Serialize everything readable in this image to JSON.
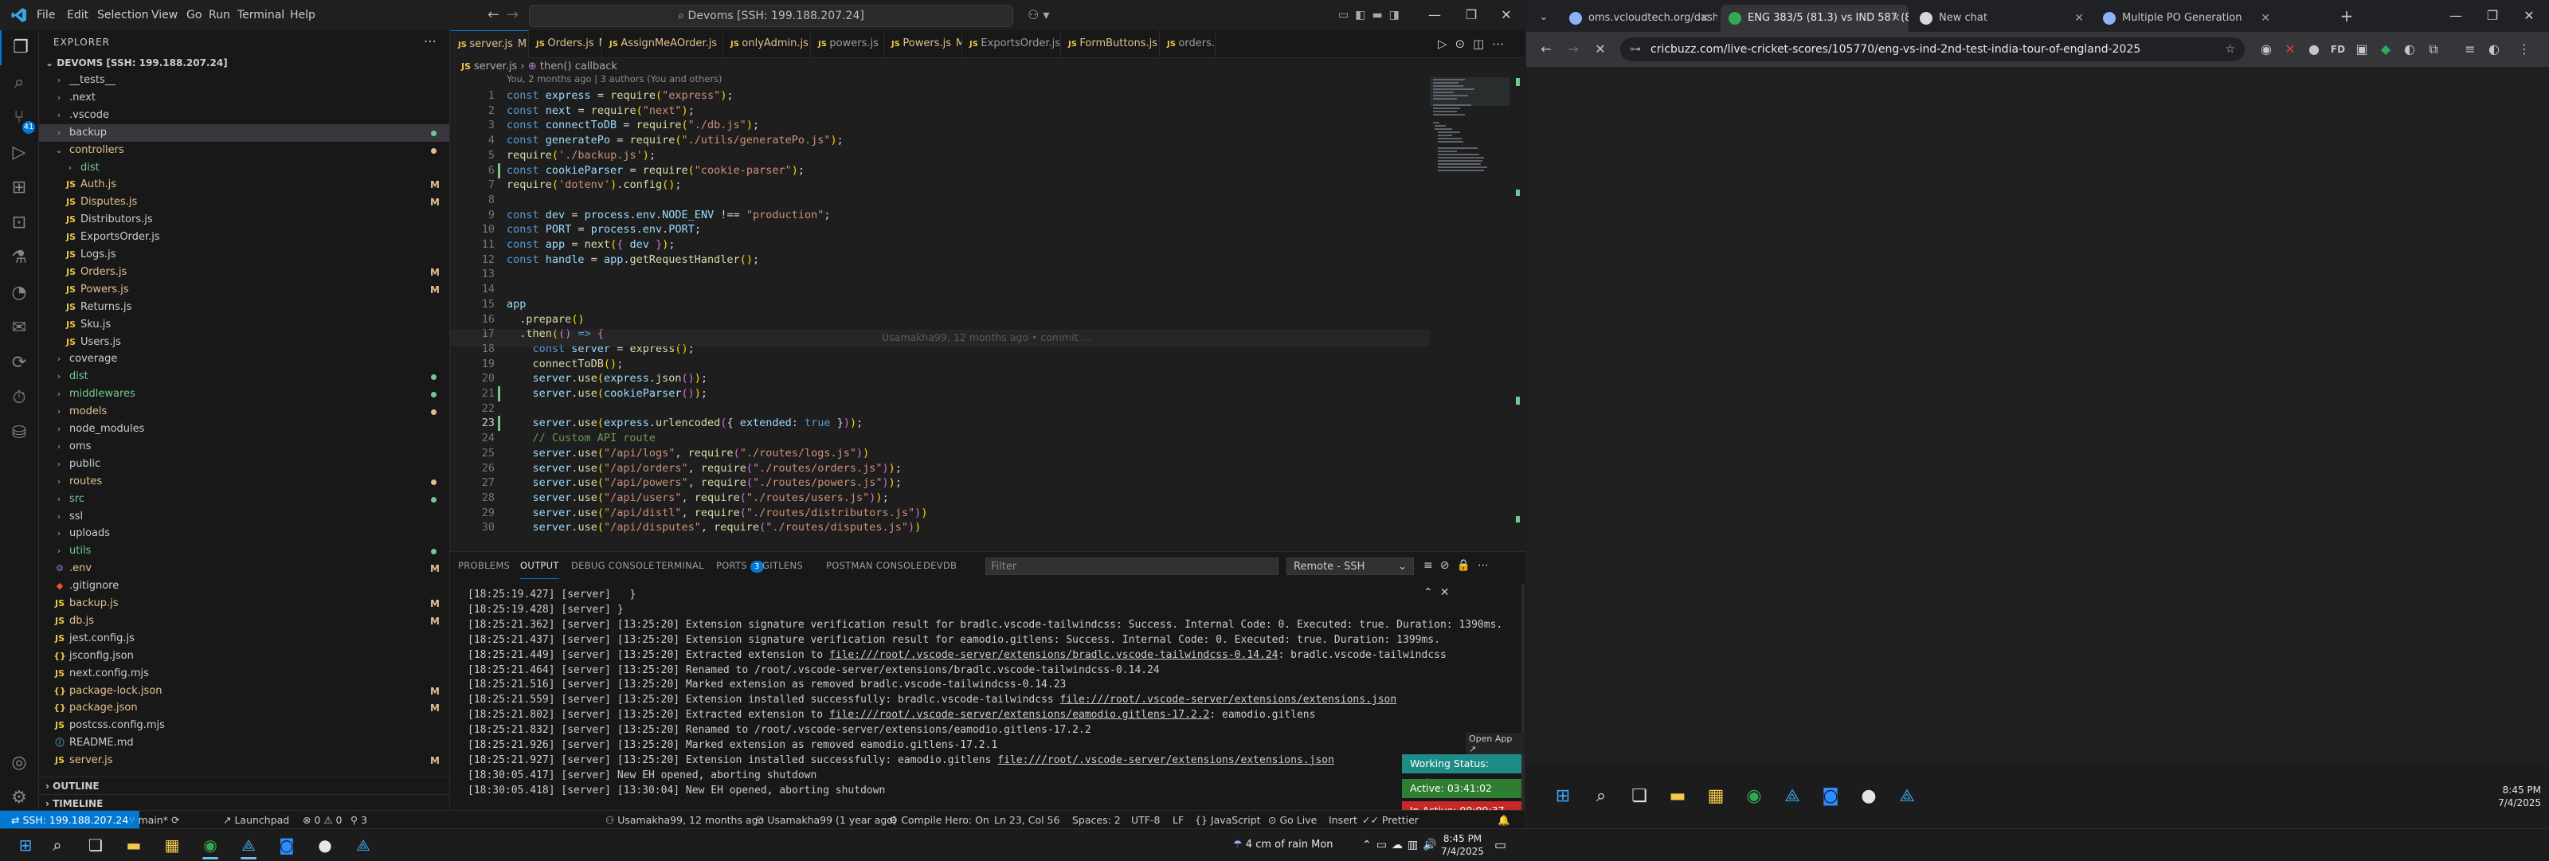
{
  "vscode": {
    "menus": [
      "File",
      "Edit",
      "Selection",
      "View",
      "Go",
      "Run",
      "Terminal",
      "Help"
    ],
    "command_center": "Devoms [SSH: 199.188.207.24]",
    "explorer_title": "EXPLORER",
    "workspace_name": "DEVOMS [SSH: 199.188.207.24]",
    "tree": [
      {
        "label": "__tests__",
        "kind": "folder",
        "open": false,
        "depth": 1,
        "color": "#cccccc"
      },
      {
        "label": ".next",
        "kind": "folder",
        "open": false,
        "depth": 1,
        "color": "#cccccc"
      },
      {
        "label": ".vscode",
        "kind": "folder",
        "open": false,
        "depth": 1,
        "color": "#cccccc"
      },
      {
        "label": "backup",
        "kind": "folder",
        "open": false,
        "depth": 1,
        "color": "#cccccc",
        "dot": "#73c991",
        "selected": true
      },
      {
        "label": "controllers",
        "kind": "folder",
        "open": true,
        "depth": 1,
        "color": "#e2c08d",
        "dot": "#e2c08d"
      },
      {
        "label": "dist",
        "kind": "folder",
        "open": false,
        "depth": 2,
        "color": "#73c991"
      },
      {
        "label": "Auth.js",
        "kind": "js",
        "depth": 2,
        "color": "#e2c08d",
        "status": "M"
      },
      {
        "label": "Disputes.js",
        "kind": "js",
        "depth": 2,
        "color": "#e2c08d",
        "status": "M"
      },
      {
        "label": "Distributors.js",
        "kind": "js",
        "depth": 2,
        "color": "#cccccc"
      },
      {
        "label": "ExportsOrder.js",
        "kind": "js",
        "depth": 2,
        "color": "#cccccc"
      },
      {
        "label": "Logs.js",
        "kind": "js",
        "depth": 2,
        "color": "#cccccc"
      },
      {
        "label": "Orders.js",
        "kind": "js",
        "depth": 2,
        "color": "#e2c08d",
        "status": "M"
      },
      {
        "label": "Powers.js",
        "kind": "js",
        "depth": 2,
        "color": "#e2c08d",
        "status": "M"
      },
      {
        "label": "Returns.js",
        "kind": "js",
        "depth": 2,
        "color": "#cccccc"
      },
      {
        "label": "Sku.js",
        "kind": "js",
        "depth": 2,
        "color": "#cccccc"
      },
      {
        "label": "Users.js",
        "kind": "js",
        "depth": 2,
        "color": "#cccccc"
      },
      {
        "label": "coverage",
        "kind": "folder",
        "open": false,
        "depth": 1,
        "color": "#cccccc"
      },
      {
        "label": "dist",
        "kind": "folder",
        "open": false,
        "depth": 1,
        "color": "#73c991",
        "dot": "#73c991"
      },
      {
        "label": "middlewares",
        "kind": "folder",
        "open": false,
        "depth": 1,
        "color": "#73c991",
        "dot": "#73c991"
      },
      {
        "label": "models",
        "kind": "folder",
        "open": false,
        "depth": 1,
        "color": "#e2c08d",
        "dot": "#e2c08d"
      },
      {
        "label": "node_modules",
        "kind": "folder",
        "open": false,
        "depth": 1,
        "color": "#cccccc"
      },
      {
        "label": "oms",
        "kind": "folder",
        "open": false,
        "depth": 1,
        "color": "#cccccc"
      },
      {
        "label": "public",
        "kind": "folder",
        "open": false,
        "depth": 1,
        "color": "#cccccc"
      },
      {
        "label": "routes",
        "kind": "folder",
        "open": false,
        "depth": 1,
        "color": "#e2c08d",
        "dot": "#e2c08d"
      },
      {
        "label": "src",
        "kind": "folder",
        "open": false,
        "depth": 1,
        "color": "#73c991",
        "dot": "#73c991"
      },
      {
        "label": "ssl",
        "kind": "folder",
        "open": false,
        "depth": 1,
        "color": "#cccccc"
      },
      {
        "label": "uploads",
        "kind": "folder",
        "open": false,
        "depth": 1,
        "color": "#cccccc"
      },
      {
        "label": "utils",
        "kind": "folder",
        "open": false,
        "depth": 1,
        "color": "#73c991",
        "dot": "#73c991"
      },
      {
        "label": ".env",
        "kind": "env",
        "depth": 1,
        "color": "#e2c08d",
        "status": "M"
      },
      {
        "label": ".gitignore",
        "kind": "git",
        "depth": 1,
        "color": "#cccccc"
      },
      {
        "label": "backup.js",
        "kind": "js",
        "depth": 1,
        "color": "#e2c08d",
        "status": "M"
      },
      {
        "label": "db.js",
        "kind": "js",
        "depth": 1,
        "color": "#e2c08d",
        "status": "M"
      },
      {
        "label": "jest.config.js",
        "kind": "js",
        "depth": 1,
        "color": "#cccccc"
      },
      {
        "label": "jsconfig.json",
        "kind": "json",
        "depth": 1,
        "color": "#cccccc"
      },
      {
        "label": "next.config.mjs",
        "kind": "js",
        "depth": 1,
        "color": "#cccccc"
      },
      {
        "label": "package-lock.json",
        "kind": "json",
        "depth": 1,
        "color": "#e2c08d",
        "status": "M"
      },
      {
        "label": "package.json",
        "kind": "json",
        "depth": 1,
        "color": "#e2c08d",
        "status": "M"
      },
      {
        "label": "postcss.config.mjs",
        "kind": "js",
        "depth": 1,
        "color": "#cccccc"
      },
      {
        "label": "README.md",
        "kind": "md",
        "depth": 1,
        "color": "#cccccc"
      },
      {
        "label": "server.js",
        "kind": "js",
        "depth": 1,
        "color": "#e2c08d",
        "status": "M"
      }
    ],
    "outline_label": "OUTLINE",
    "timeline_label": "TIMELINE",
    "tabs": [
      {
        "label": "server.js",
        "status": "M",
        "active": true,
        "close": "×"
      },
      {
        "label": "Orders.js",
        "status": "M"
      },
      {
        "label": "AssignMeAOrder.js",
        "status": "M"
      },
      {
        "label": "onlyAdmin.js",
        "status": "M"
      },
      {
        "label": "powers.js",
        "status": ""
      },
      {
        "label": "Powers.js",
        "status": "M"
      },
      {
        "label": "ExportsOrder.js",
        "status": ""
      },
      {
        "label": "FormButtons.js",
        "status": "M"
      },
      {
        "label": "orders.js",
        "status": ""
      }
    ],
    "breadcrumb": [
      "server.js",
      "then() callback"
    ],
    "blame_header": "You, 2 months ago | 3 authors (You and others)",
    "inline_blame": "Usamakha99, 12 months ago • commit …",
    "code": [
      {
        "n": "1",
        "html": "<span class='k'>const</span> <span class='v'>express</span> <span class='p'>=</span> <span class='f'>require</span><span class='br'>(</span><span class='s'>\"express\"</span><span class='br'>)</span><span class='p'>;</span>"
      },
      {
        "n": "2",
        "html": "<span class='k'>const</span> <span class='v'>next</span> <span class='p'>=</span> <span class='f'>require</span><span class='br'>(</span><span class='s'>\"next\"</span><span class='br'>)</span><span class='p'>;</span>"
      },
      {
        "n": "3",
        "html": "<span class='k'>const</span> <span class='v'>connectToDB</span> <span class='p'>=</span> <span class='f'>require</span><span class='br'>(</span><span class='s'>\"./db.js\"</span><span class='br'>)</span><span class='p'>;</span>"
      },
      {
        "n": "4",
        "html": "<span class='k'>const</span> <span class='v'>generatePo</span> <span class='p'>=</span> <span class='f'>require</span><span class='br'>(</span><span class='s'>\"./utils/generatePo.js\"</span><span class='br'>)</span><span class='p'>;</span>"
      },
      {
        "n": "5",
        "html": "<span class='f'>require</span><span class='br'>(</span><span class='s'>'./backup.js'</span><span class='br'>)</span><span class='p'>;</span>"
      },
      {
        "n": "6",
        "html": "<span class='k'>const</span> <span class='v'>cookieParser</span> <span class='p'>=</span> <span class='f'>require</span><span class='br'>(</span><span class='s'>\"cookie-parser\"</span><span class='br'>)</span><span class='p'>;</span>"
      },
      {
        "n": "7",
        "html": "<span class='f'>require</span><span class='br'>(</span><span class='s'>'dotenv'</span><span class='br'>)</span><span class='p'>.</span><span class='f'>config</span><span class='br'>()</span><span class='p'>;</span>"
      },
      {
        "n": "8",
        "html": ""
      },
      {
        "n": "9",
        "html": "<span class='k'>const</span> <span class='v'>dev</span> <span class='p'>=</span> <span class='v'>process</span><span class='p'>.</span><span class='v'>env</span><span class='p'>.</span><span class='v'>NODE_ENV</span> <span class='p'>!==</span> <span class='s'>\"production\"</span><span class='p'>;</span>"
      },
      {
        "n": "10",
        "html": "<span class='k'>const</span> <span class='v'>PORT</span> <span class='p'>=</span> <span class='v'>process</span><span class='p'>.</span><span class='v'>env</span><span class='p'>.</span><span class='v'>PORT</span><span class='p'>;</span>"
      },
      {
        "n": "11",
        "html": "<span class='k'>const</span> <span class='v'>app</span> <span class='p'>=</span> <span class='f'>next</span><span class='br'>(</span><span class='br2'>{</span> <span class='v'>dev</span> <span class='br2'>}</span><span class='br'>)</span><span class='p'>;</span>"
      },
      {
        "n": "12",
        "html": "<span class='k'>const</span> <span class='v'>handle</span> <span class='p'>=</span> <span class='v'>app</span><span class='p'>.</span><span class='f'>getRequestHandler</span><span class='br'>()</span><span class='p'>;</span>"
      },
      {
        "n": "13",
        "html": ""
      },
      {
        "n": "14",
        "html": ""
      },
      {
        "n": "15",
        "html": "<span class='v'>app</span>"
      },
      {
        "n": "16",
        "html": "  <span class='p'>.</span><span class='f'>prepare</span><span class='br'>()</span>"
      },
      {
        "n": "17",
        "html": "  <span class='p'>.</span><span class='f'>then</span><span class='br'>(</span><span class='br2'>()</span> <span class='k'>=&gt;</span> <span class='br2'>{</span>"
      },
      {
        "n": "18",
        "html": "    <span class='k'>const</span> <span class='v'>server</span> <span class='p'>=</span> <span class='f'>express</span><span class='br'>()</span><span class='p'>;</span>"
      },
      {
        "n": "19",
        "html": "    <span class='f'>connectToDB</span><span class='br'>()</span><span class='p'>;</span>"
      },
      {
        "n": "20",
        "html": "    <span class='v'>server</span><span class='p'>.</span><span class='f'>use</span><span class='br'>(</span><span class='v'>express</span><span class='p'>.</span><span class='f'>json</span><span class='br2'>()</span><span class='br'>)</span><span class='p'>;</span>"
      },
      {
        "n": "21",
        "html": "    <span class='v'>server</span><span class='p'>.</span><span class='f'>use</span><span class='br'>(</span><span class='v'>cookieParser</span><span class='br2'>()</span><span class='br'>)</span><span class='p'>;</span>"
      },
      {
        "n": "22",
        "html": ""
      },
      {
        "n": "23",
        "html": "    <span class='v'>server</span><span class='p'>.</span><span class='f'>use</span><span class='br'>(</span><span class='v'>express</span><span class='p'>.</span><span class='f'>urlencoded</span><span class='br2'>(</span><span class='p'>{</span> <span class='v'>extended</span><span class='p'>:</span> <span class='k'>true</span> <span class='p'>}</span><span class='br2'>)</span><span class='br'>)</span><span class='p'>;</span>"
      },
      {
        "n": "24",
        "html": "    <span class='c'>// Custom API route</span>"
      },
      {
        "n": "25",
        "html": "    <span class='v'>server</span><span class='p'>.</span><span class='f'>use</span><span class='br'>(</span><span class='s'>\"/api/logs\"</span><span class='p'>,</span> <span class='f'>require</span><span class='br2'>(</span><span class='s'>\"./routes/logs.js\"</span><span class='br2'>)</span><span class='br'>)</span>"
      },
      {
        "n": "26",
        "html": "    <span class='v'>server</span><span class='p'>.</span><span class='f'>use</span><span class='br'>(</span><span class='s'>\"/api/orders\"</span><span class='p'>,</span> <span class='f'>require</span><span class='br2'>(</span><span class='s'>\"./routes/orders.js\"</span><span class='br2'>)</span><span class='br'>)</span><span class='p'>;</span>"
      },
      {
        "n": "27",
        "html": "    <span class='v'>server</span><span class='p'>.</span><span class='f'>use</span><span class='br'>(</span><span class='s'>\"/api/powers\"</span><span class='p'>,</span> <span class='f'>require</span><span class='br2'>(</span><span class='s'>\"./routes/powers.js\"</span><span class='br2'>)</span><span class='br'>)</span><span class='p'>;</span>"
      },
      {
        "n": "28",
        "html": "    <span class='v'>server</span><span class='p'>.</span><span class='f'>use</span><span class='br'>(</span><span class='s'>\"/api/users\"</span><span class='p'>,</span> <span class='f'>require</span><span class='br2'>(</span><span class='s'>\"./routes/users.js\"</span><span class='br2'>)</span><span class='br'>)</span><span class='p'>;</span>"
      },
      {
        "n": "29",
        "html": "    <span class='v'>server</span><span class='p'>.</span><span class='f'>use</span><span class='br'>(</span><span class='s'>\"/api/distl\"</span><span class='p'>,</span> <span class='f'>require</span><span class='br2'>(</span><span class='s'>\"./routes/distributors.js\"</span><span class='br2'>)</span><span class='br'>)</span>"
      },
      {
        "n": "30",
        "html": "    <span class='v'>server</span><span class='p'>.</span><span class='f'>use</span><span class='br'>(</span><span class='s'>\"/api/disputes\"</span><span class='p'>,</span> <span class='f'>require</span><span class='br2'>(</span><span class='s'>\"./routes/disputes.js\"</span><span class='br2'>)</span><span class='br'>)</span>"
      }
    ],
    "panel_tabs": [
      {
        "label": "PROBLEMS"
      },
      {
        "label": "OUTPUT",
        "active": true
      },
      {
        "label": "DEBUG CONSOLE"
      },
      {
        "label": "TERMINAL"
      },
      {
        "label": "PORTS",
        "badge": "3"
      },
      {
        "label": "GITLENS"
      },
      {
        "label": "POSTMAN CONSOLE"
      },
      {
        "label": "DEVDB"
      }
    ],
    "filter_placeholder": "Filter",
    "output_channel": "Remote - SSH",
    "output": [
      "[18:25:19.427] [server]   }",
      "[18:25:19.428] [server] }",
      "[18:25:21.362] [server] [13:25:20] Extension signature verification result for bradlc.vscode-tailwindcss: Success. Internal Code: 0. Executed: true. Duration: 1390ms.",
      "[18:25:21.437] [server] [13:25:20] Extension signature verification result for eamodio.gitlens: Success. Internal Code: 0. Executed: true. Duration: 1399ms.",
      "[18:25:21.449] [server] [13:25:20] Extracted extension to |file:///root/.vscode-server/extensions/bradlc.vscode-tailwindcss-0.14.24|: bradlc.vscode-tailwindcss",
      "[18:25:21.464] [server] [13:25:20] Renamed to /root/.vscode-server/extensions/bradlc.vscode-tailwindcss-0.14.24",
      "[18:25:21.516] [server] [13:25:20] Marked extension as removed bradlc.vscode-tailwindcss-0.14.23",
      "[18:25:21.559] [server] [13:25:20] Extension installed successfully: bradlc.vscode-tailwindcss |file:///root/.vscode-server/extensions/extensions.json|",
      "[18:25:21.802] [server] [13:25:20] Extracted extension to |file:///root/.vscode-server/extensions/eamodio.gitlens-17.2.2|: eamodio.gitlens",
      "[18:25:21.832] [server] [13:25:20] Renamed to /root/.vscode-server/extensions/eamodio.gitlens-17.2.2",
      "[18:25:21.926] [server] [13:25:20] Marked extension as removed eamodio.gitlens-17.2.1",
      "[18:25:21.927] [server] [13:25:20] Extension installed successfully: eamodio.gitlens |file:///root/.vscode-server/extensions/extensions.json|",
      "[18:30:05.417] [server] New EH opened, aborting shutdown",
      "[18:30:05.418] [server] [13:30:04] New EH opened, aborting shutdown"
    ],
    "work_widget": {
      "open_app": "Open App ↗",
      "working_status": "Working Status: Active",
      "active": "Active: 03:41:02",
      "inactive": "In Active: 00:09:37",
      "colors": {
        "working": "#1e8c86",
        "active": "#2e7d32",
        "inactive": "#c62828"
      }
    },
    "status": {
      "remote": "SSH: 199.188.207.24",
      "branch": "main*",
      "sync": "⟳",
      "launchpad": "Launchpad",
      "problems": "⊗ 0 ⚠ 0",
      "ports": "⚲ 3",
      "blame": "Usamakha99, 12 months ago",
      "author": "Usamakha99 (1 year ago)",
      "compile": "Compile Hero: On",
      "position": "Ln 23, Col 56",
      "spaces": "Spaces: 2",
      "encoding": "UTF-8",
      "eol": "LF",
      "language": "{} JavaScript",
      "golive": "Go Live",
      "insert": "Insert",
      "prettier": "Prettier"
    }
  },
  "chrome": {
    "tabs": [
      {
        "label": "oms.vcloudtech.org/dashboard",
        "favicon": "#8ab4f8"
      },
      {
        "label": "ENG 383/5 (81.3) vs IND 587 (8",
        "favicon": "#34a853",
        "active": true
      },
      {
        "label": "New chat",
        "favicon": "#d7d7d7"
      },
      {
        "label": "Multiple PO Generation",
        "favicon": "#8ab4f8"
      }
    ],
    "url": "cricbuzz.com/live-cricket-scores/105770/eng-vs-ind-2nd-test-india-tour-of-england-2025",
    "time": "8:45 PM",
    "date": "7/4/2025"
  },
  "taskbar": {
    "weather": "4 cm of rain Mon",
    "time": "8:45 PM",
    "date": "7/4/2025",
    "apps": [
      "file-explorer",
      "microsoft-store",
      "chrome",
      "vscode",
      "zoom",
      "app-circle",
      "app-vscode-dev"
    ]
  }
}
